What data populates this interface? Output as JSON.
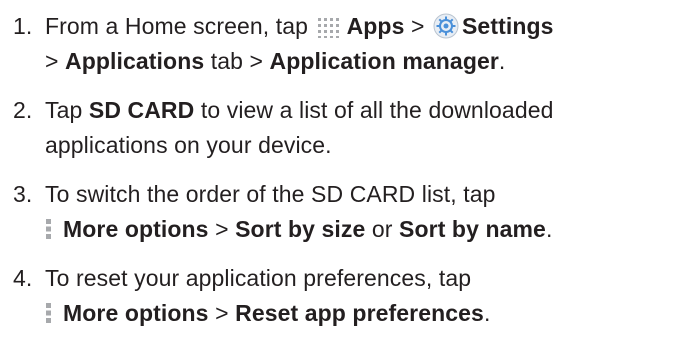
{
  "steps": [
    {
      "number": "1.",
      "line1": {
        "t1": "From a Home screen, tap ",
        "apps": "Apps",
        "t2": " > ",
        "settings": "Settings"
      },
      "line2": {
        "t1": "> ",
        "b1": "Applications",
        "t2": " tab > ",
        "b2": "Application manager",
        "t3": "."
      }
    },
    {
      "number": "2.",
      "line1": {
        "t1": "Tap ",
        "b1": "SD CARD",
        "t2": " to view a list of all the downloaded"
      },
      "line2": {
        "t1": "applications on your device."
      }
    },
    {
      "number": "3.",
      "line1": {
        "t1": "To switch the order of the SD CARD list, tap"
      },
      "line2": {
        "b1": "More options",
        "t1": " > ",
        "b2": "Sort by size",
        "t2": " or ",
        "b3": "Sort by name",
        "t3": "."
      }
    },
    {
      "number": "4.",
      "line1": {
        "t1": "To reset your application preferences, tap"
      },
      "line2": {
        "b1": "More options",
        "t1": " > ",
        "b2": "Reset app preferences",
        "t2": "."
      }
    }
  ],
  "icons": {
    "apps": "apps-grid-icon",
    "settings": "settings-gear-icon",
    "more_options": "more-options-icon"
  },
  "colors": {
    "text": "#231f20",
    "icon_gray": "#a7a9ac",
    "settings_blue": "#4a90d9"
  }
}
